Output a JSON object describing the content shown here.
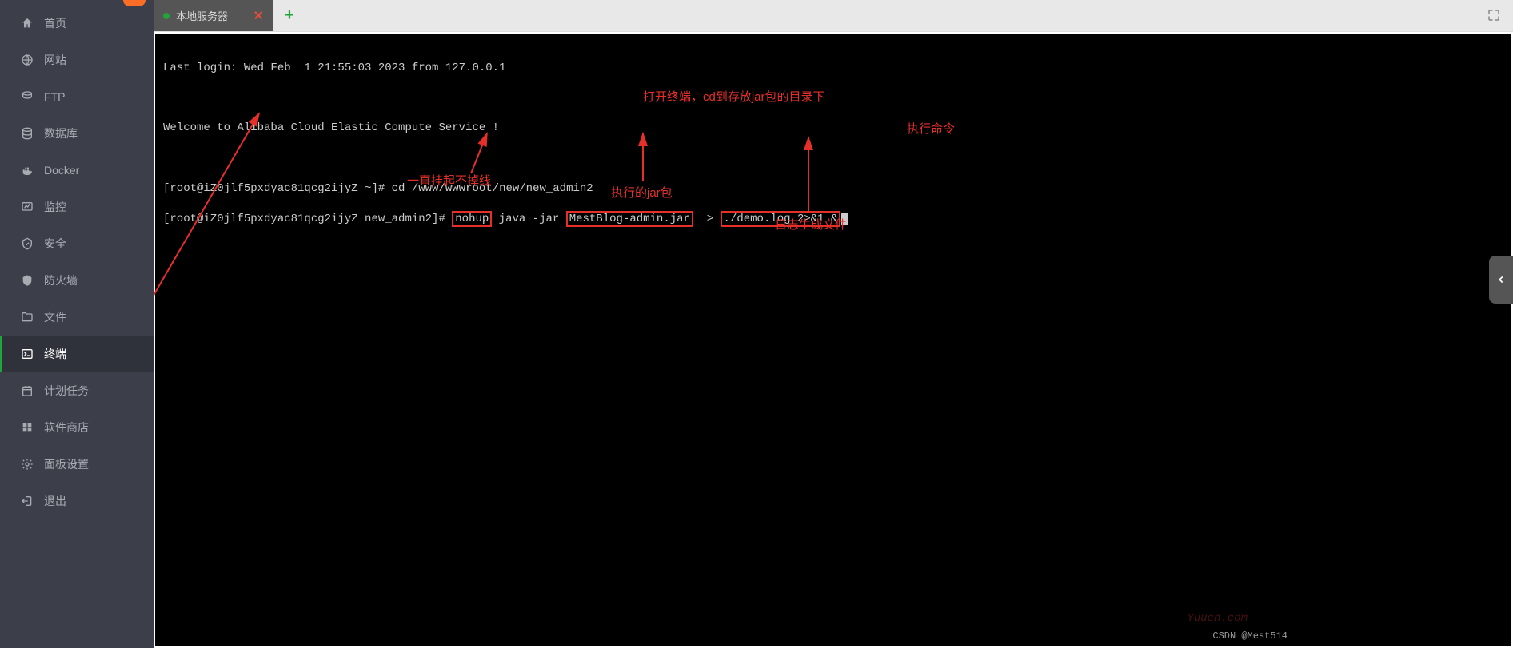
{
  "sidebar": {
    "items": [
      {
        "label": "首页",
        "icon": "home"
      },
      {
        "label": "网站",
        "icon": "globe"
      },
      {
        "label": "FTP",
        "icon": "ftp"
      },
      {
        "label": "数据库",
        "icon": "database"
      },
      {
        "label": "Docker",
        "icon": "docker"
      },
      {
        "label": "监控",
        "icon": "monitor"
      },
      {
        "label": "安全",
        "icon": "shield"
      },
      {
        "label": "防火墙",
        "icon": "firewall"
      },
      {
        "label": "文件",
        "icon": "folder"
      },
      {
        "label": "终端",
        "icon": "terminal",
        "active": true
      },
      {
        "label": "计划任务",
        "icon": "calendar"
      },
      {
        "label": "软件商店",
        "icon": "apps"
      },
      {
        "label": "面板设置",
        "icon": "gear"
      },
      {
        "label": "退出",
        "icon": "logout"
      }
    ]
  },
  "tabs": {
    "active": {
      "label": "本地服务器"
    }
  },
  "terminal": {
    "last_login": "Last login: Wed Feb  1 21:55:03 2023 from 127.0.0.1",
    "welcome": "Welcome to Alibaba Cloud Elastic Compute Service !",
    "prompt1_user": "[root@iZ0jlf5pxdyac81qcg2ijyZ ~]#",
    "prompt1_cmd": " cd /www/wwwroot/new/new_admin2",
    "prompt2_user": "[root@iZ0jlf5pxdyac81qcg2ijyZ new_admin2]#",
    "cmd_nohup": "nohup",
    "cmd_java": " java -jar ",
    "cmd_jar": "MestBlog-admin.jar",
    "cmd_redirect": "  > ",
    "cmd_log": "./demo.log 2>&1 &"
  },
  "annotations": {
    "open_terminal": "打开终端，cd到存放jar包的目录下",
    "exec_cmd": "执行命令",
    "nohup_note": "一直挂起不掉线",
    "jar_note": "执行的jar包",
    "log_note": "日志生成文件"
  },
  "watermarks": {
    "csdn": "CSDN @Mest514",
    "site": "Yuucn.com"
  }
}
